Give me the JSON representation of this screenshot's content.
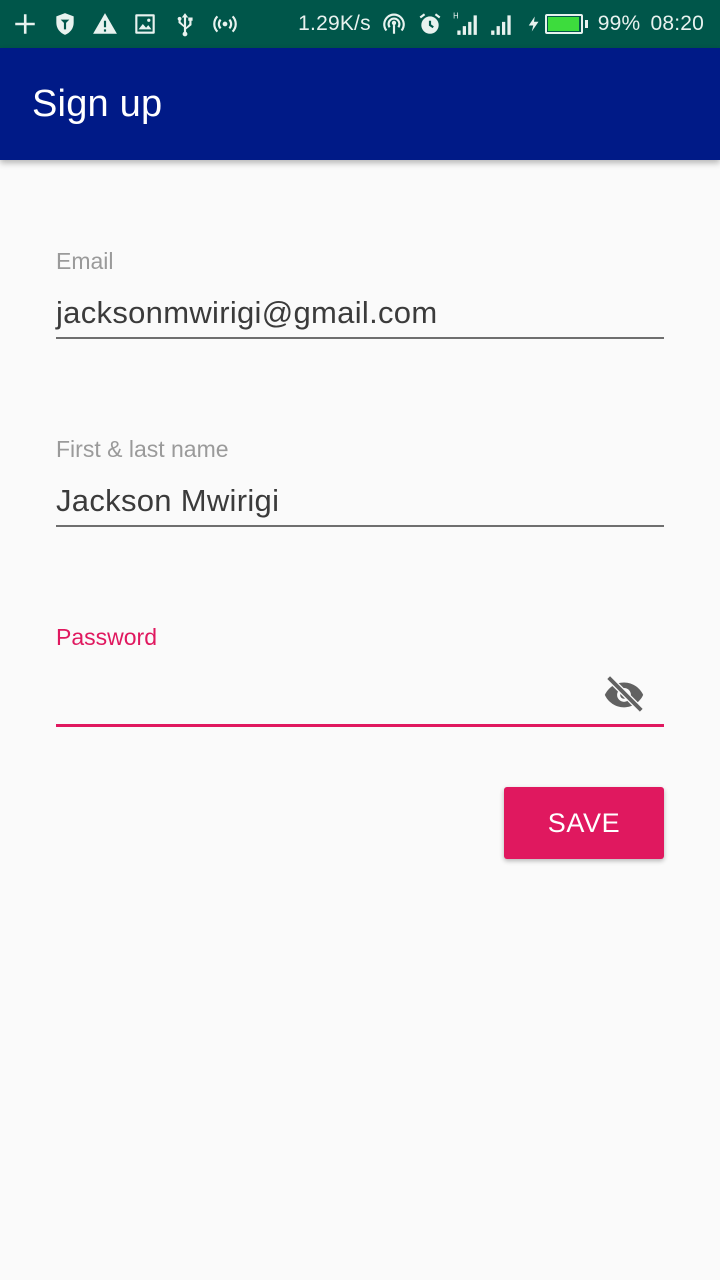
{
  "status_bar": {
    "icons": [
      "add-icon",
      "shield-icon",
      "warning-icon",
      "image-icon",
      "usb-icon",
      "hotspot-icon"
    ],
    "net_speed": "1.29K/s",
    "right_icons": [
      "wifi-tethering-icon",
      "alarm-icon",
      "signal-h-icon",
      "signal-icon",
      "charging-icon"
    ],
    "battery_percent": "99%",
    "battery_level": 0.99,
    "time": "08:20",
    "colors": {
      "background": "#00564a",
      "battery_fill": "#3ddc3d"
    }
  },
  "app_bar": {
    "title": "Sign up",
    "color": "#001a87"
  },
  "form": {
    "email": {
      "label": "Email",
      "value": "jacksonmwirigi@gmail.com"
    },
    "name": {
      "label": "First & last name",
      "value": "Jackson Mwirigi"
    },
    "password": {
      "label": "Password",
      "value": "",
      "toggle_icon": "visibility-off-icon"
    },
    "save_label": "SAVE",
    "accent_color": "#e0185f"
  }
}
